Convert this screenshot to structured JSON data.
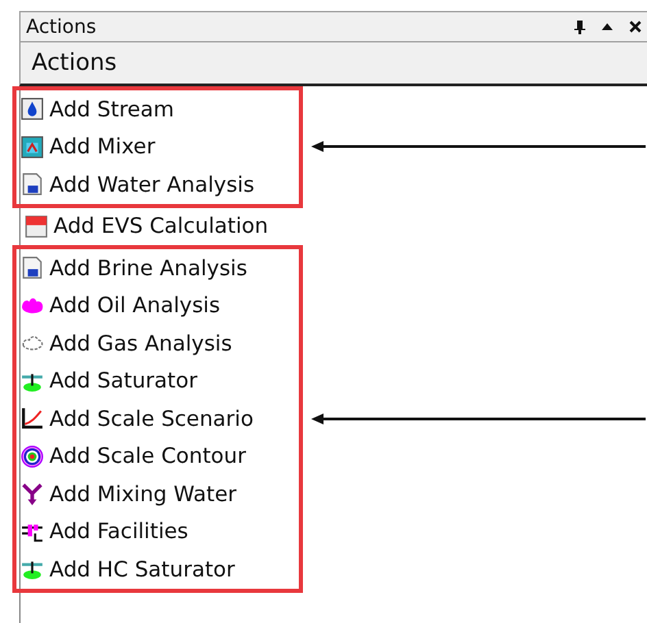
{
  "panel": {
    "title": "Actions",
    "header": "Actions"
  },
  "groups": [
    {
      "highlighted": true,
      "arrow": true,
      "items": [
        "Add Stream",
        "Add Mixer",
        "Add Water Analysis"
      ]
    },
    {
      "highlighted": false,
      "arrow": false,
      "items": [
        "Add EVS Calculation"
      ]
    },
    {
      "highlighted": true,
      "arrow": true,
      "items": [
        "Add Brine Analysis",
        "Add Oil Analysis",
        "Add Gas Analysis",
        "Add Saturator",
        "Add Scale Scenario",
        "Add Scale Contour",
        "Add Mixing Water",
        "Add Facilities",
        "Add HC Saturator"
      ]
    }
  ]
}
